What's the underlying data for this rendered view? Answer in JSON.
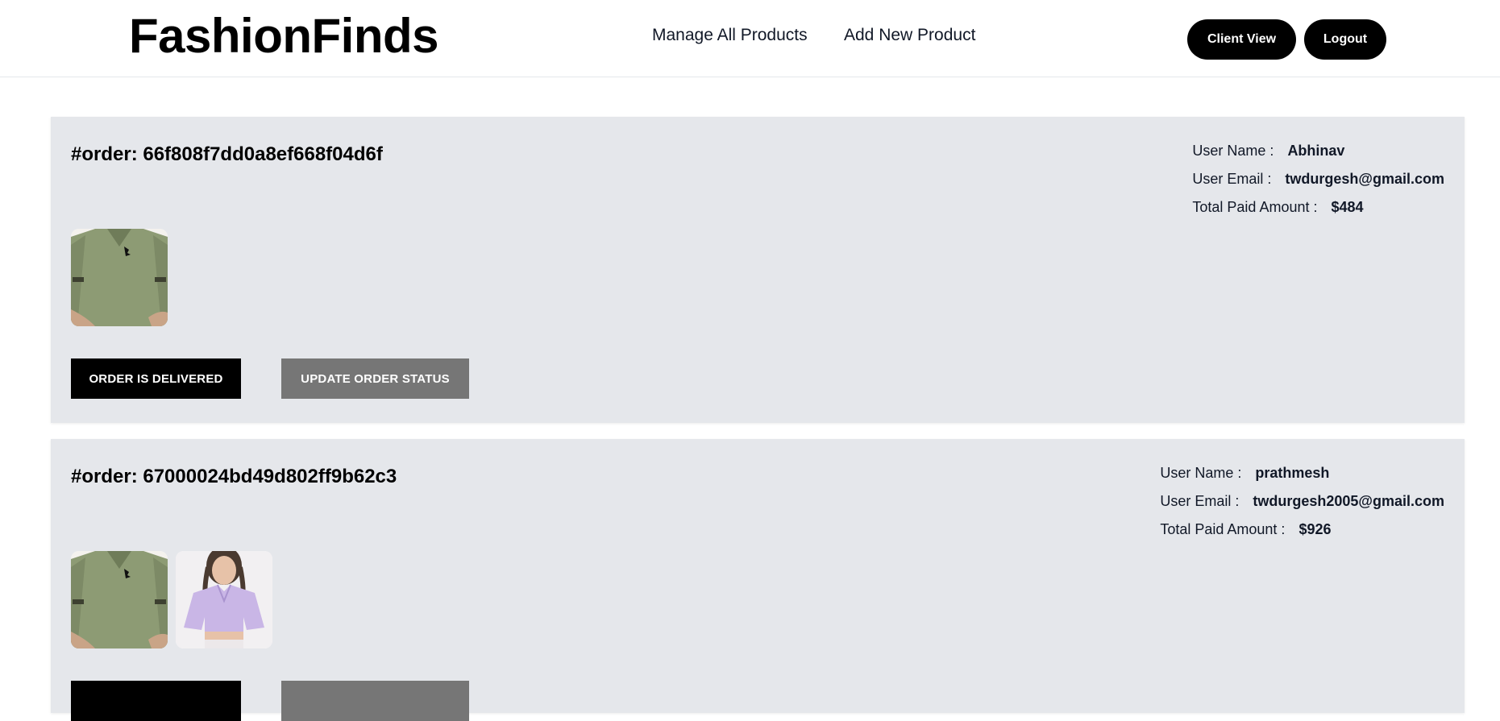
{
  "header": {
    "logo": "FashionFinds",
    "nav": [
      {
        "label": "Manage All Products"
      },
      {
        "label": "Add New Product"
      }
    ],
    "buttons": {
      "client_view": "Client View",
      "logout": "Logout"
    }
  },
  "orders": [
    {
      "order_id": "#order: 66f808f7dd0a8ef668f04d6f",
      "user_name_label": "User Name :",
      "user_name": "Abhinav",
      "user_email_label": "User Email :",
      "user_email": "twdurgesh@gmail.com",
      "total_label": "Total Paid Amount :",
      "total": "$484",
      "products": [
        "olive-polo-shirt"
      ],
      "status_button": "ORDER IS DELIVERED",
      "update_button": "UPDATE ORDER STATUS"
    },
    {
      "order_id": "#order: 67000024bd49d802ff9b62c3",
      "user_name_label": "User Name :",
      "user_name": "prathmesh",
      "user_email_label": "User Email :",
      "user_email": "twdurgesh2005@gmail.com",
      "total_label": "Total Paid Amount :",
      "total": "$926",
      "products": [
        "olive-polo-shirt",
        "lavender-crop-shirt"
      ],
      "status_button": "",
      "update_button": ""
    }
  ],
  "colors": {
    "card_bg": "#e5e7eb",
    "primary_button": "#000000",
    "secondary_button": "#767676"
  }
}
